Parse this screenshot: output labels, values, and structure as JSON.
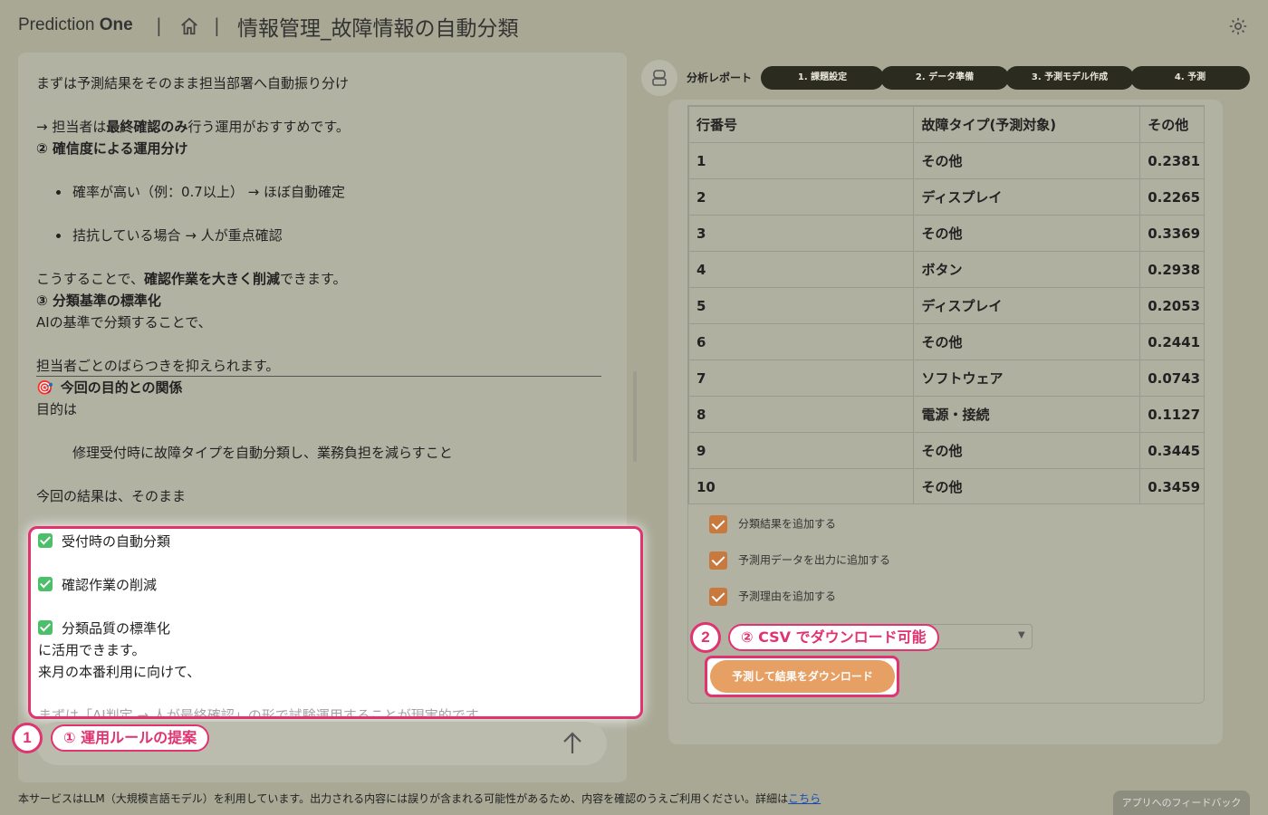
{
  "header": {
    "brand_light": "Prediction ",
    "brand_bold": "One",
    "separator": "|",
    "page_title": "情報管理_故障情報の自動分類",
    "home_icon": "home-icon",
    "settings_icon": "gear-icon"
  },
  "chat": {
    "lines": [
      "まずは予測結果をそのまま担当部署へ自動振り分け",
      "",
      "→ 担当者は",
      "最終確認のみ",
      "行う運用がおすすめです。",
      "② 確信度による運用分け",
      "",
      "確率が高い（例：0.7以上） → ほぼ自動確定",
      "",
      "拮抗している場合 → 人が重点確認",
      "",
      "こうすることで、",
      "確認作業を大きく削減",
      "できます。",
      "③ 分類基準の標準化",
      "AIの基準で分類することで、",
      "",
      "担当者ごとのばらつきを抑えられます。",
      "🎯",
      "今回の目的との関係",
      "目的は",
      "",
      "修理受付時に故障タイプを自動分類し、業務負担を減らすこと",
      "",
      "今回の結果は、そのまま"
    ],
    "checks": [
      "受付時の自動分類",
      "確認作業の削減",
      "分類品質の標準化"
    ],
    "after_checks": [
      "に活用できます。",
      "来月の本番利用に向けて、",
      "まずは「AI判定 → 人が最終確認」の形で試験運用することが現実的です。"
    ],
    "send_icon": "arrow-up-icon"
  },
  "annotations": {
    "badge1": "1",
    "callout1": "① 運用ルールの提案",
    "badge2": "2",
    "callout2": "② CSV でダウンロード可能"
  },
  "report": {
    "label": "分析レポート",
    "avatar_icon": "report-icon",
    "steps": [
      "1. 課題設定",
      "2. データ準備",
      "3. 予測モデル作成",
      "4. 予測"
    ]
  },
  "table": {
    "headers": [
      "行番号",
      "故障タイプ(予測対象)",
      "その他"
    ],
    "rows": [
      [
        "1",
        "その他",
        "0.2381"
      ],
      [
        "2",
        "ディスプレイ",
        "0.2265"
      ],
      [
        "3",
        "その他",
        "0.3369"
      ],
      [
        "4",
        "ボタン",
        "0.2938"
      ],
      [
        "5",
        "ディスプレイ",
        "0.2053"
      ],
      [
        "6",
        "その他",
        "0.2441"
      ],
      [
        "7",
        "ソフトウェア",
        "0.0743"
      ],
      [
        "8",
        "電源・接続",
        "0.1127"
      ],
      [
        "9",
        "その他",
        "0.3445"
      ],
      [
        "10",
        "その他",
        "0.3459"
      ]
    ]
  },
  "options": [
    "分類結果を追加する",
    "予測用データを出力に追加する",
    "予測理由を追加する"
  ],
  "download_button": "予測して結果をダウンロード",
  "footer": {
    "text": "本サービスはLLM（大規模言語モデル）を利用しています。出力される内容には誤りが含まれる可能性があるため、内容を確認のうえご利用ください。詳細は",
    "link": "こちら",
    "feedback": "アプリへのフィードバック"
  },
  "colors": {
    "accent": "#e0336f",
    "button": "#e6a063",
    "checkbox": "#c8793d",
    "step_bg": "#2c2b20"
  }
}
